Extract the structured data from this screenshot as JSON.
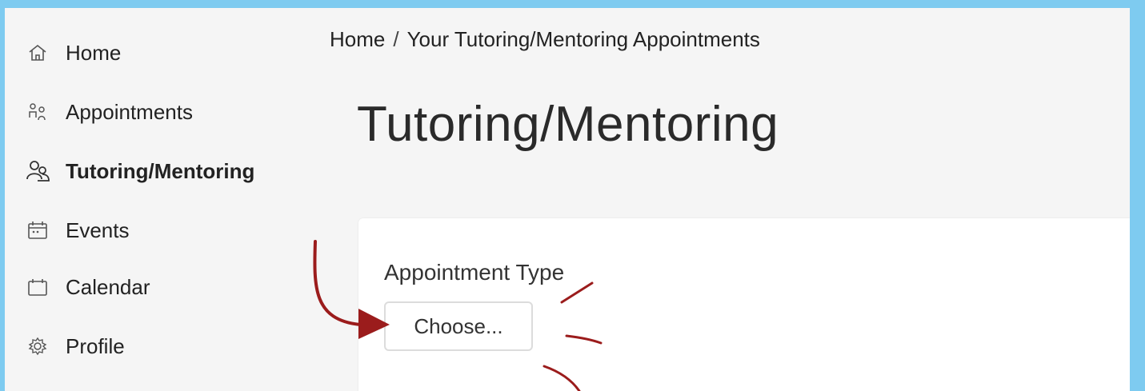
{
  "sidebar": {
    "items": [
      {
        "label": "Home",
        "icon": "home-icon"
      },
      {
        "label": "Appointments",
        "icon": "people-icon"
      },
      {
        "label": "Tutoring/Mentoring",
        "icon": "tutoring-icon",
        "active": true
      },
      {
        "label": "Events",
        "icon": "events-calendar-icon"
      },
      {
        "label": "Calendar",
        "icon": "calendar-icon"
      },
      {
        "label": "Profile",
        "icon": "gear-icon"
      }
    ]
  },
  "breadcrumb": {
    "home": "Home",
    "separator": "/",
    "current": "Your Tutoring/Mentoring Appointments"
  },
  "page": {
    "title": "Tutoring/Mentoring"
  },
  "form": {
    "appointment_type_label": "Appointment Type",
    "choose_button_label": "Choose..."
  },
  "colors": {
    "frame": "#7ecbf0",
    "background": "#f5f5f5",
    "card": "#ffffff",
    "annotation": "#9b1c1c"
  }
}
